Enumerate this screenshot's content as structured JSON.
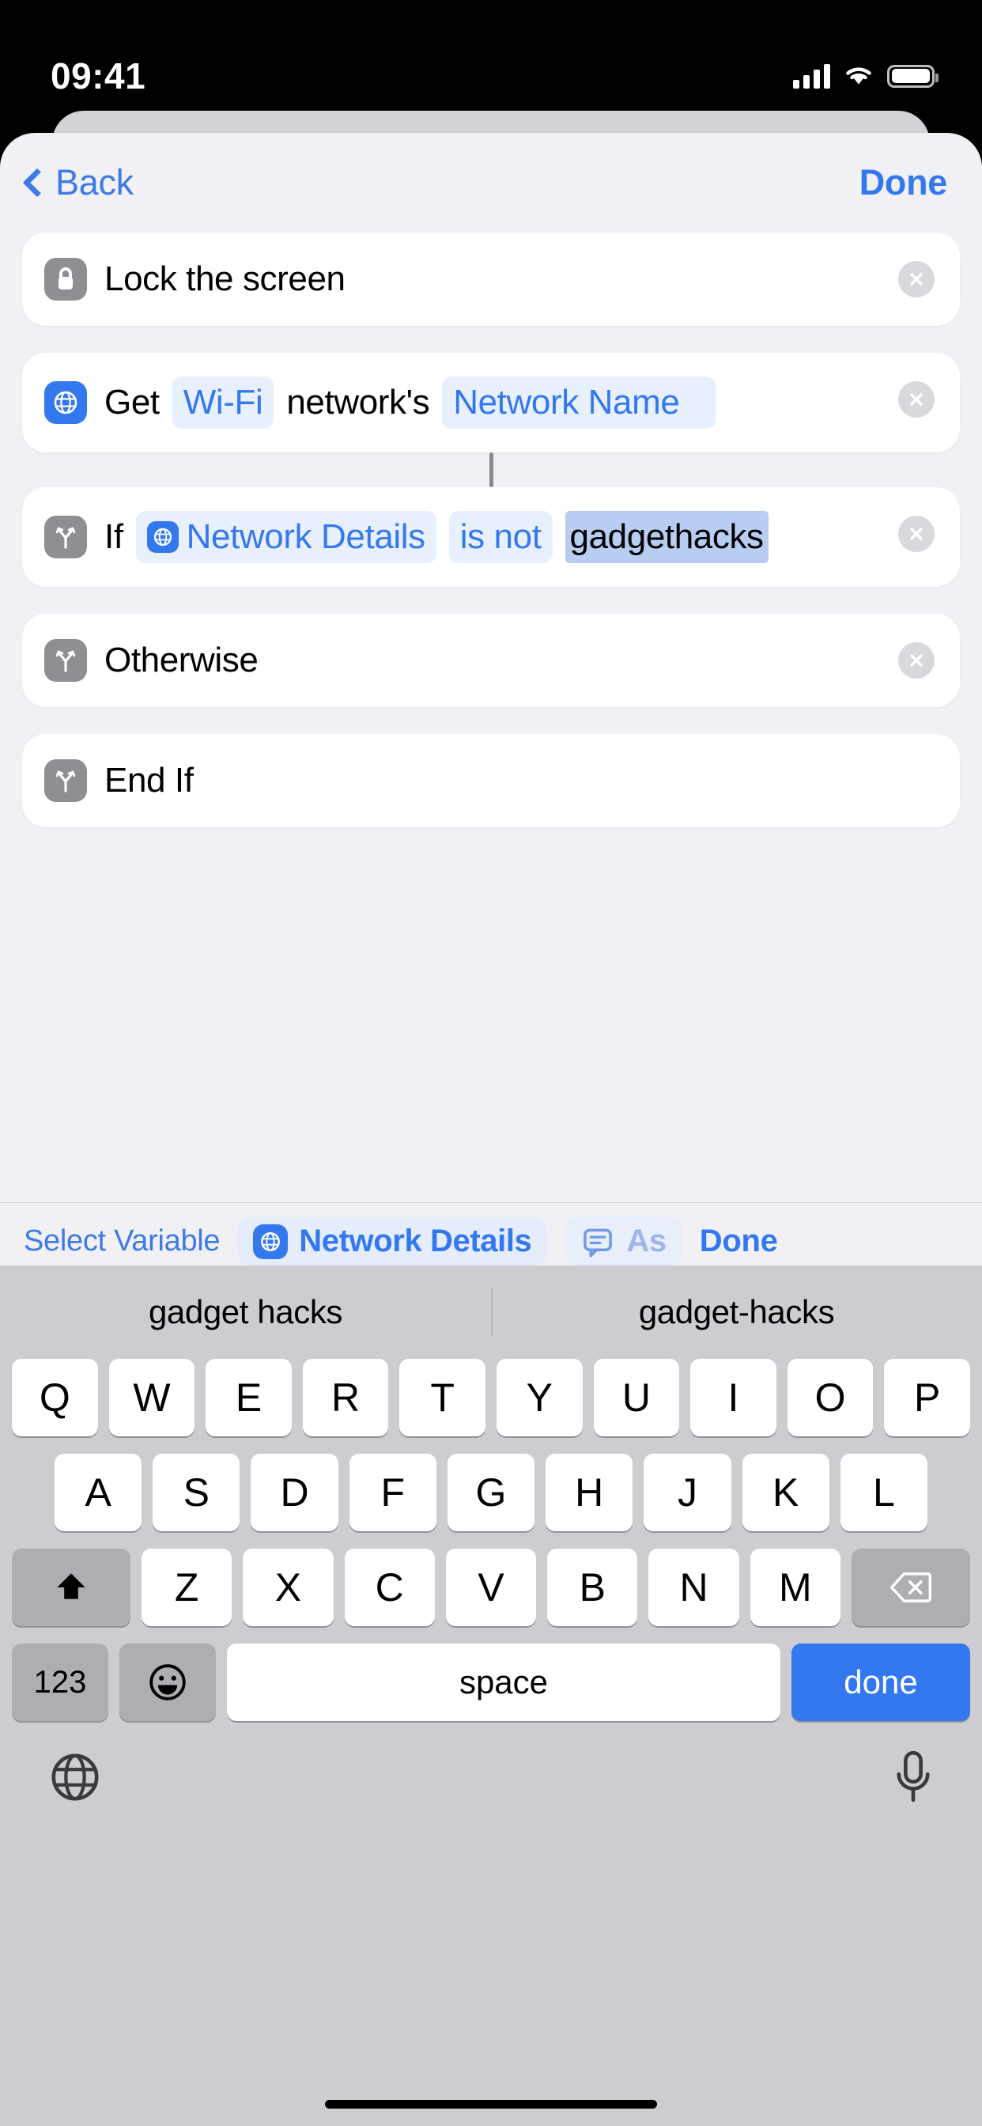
{
  "status_bar": {
    "time": "09:41",
    "signal_icon": "cellular-bars-icon",
    "wifi_icon": "wifi-icon",
    "battery_icon": "battery-icon"
  },
  "nav": {
    "back_label": "Back",
    "done_label": "Done",
    "back_icon": "chevron-left-icon"
  },
  "actions": [
    {
      "id": "lock-screen",
      "icon": "lock-icon",
      "icon_color": "#8e8e93",
      "parts": [
        {
          "type": "text",
          "value": "Lock the screen"
        }
      ],
      "remove_icon": "close-circle-icon"
    },
    {
      "id": "get-wifi-network",
      "icon": "globe-icon",
      "icon_color": "#3478f0",
      "parts": [
        {
          "type": "text",
          "value": "Get"
        },
        {
          "type": "token",
          "value": "Wi-Fi"
        },
        {
          "type": "text",
          "value": "network's"
        },
        {
          "type": "token",
          "value": "Network Name"
        }
      ],
      "remove_icon": "close-circle-icon"
    },
    {
      "id": "if-condition",
      "icon": "branch-icon",
      "icon_color": "#8e8e93",
      "parts": [
        {
          "type": "text",
          "value": "If"
        },
        {
          "type": "var-token",
          "value": "Network Details",
          "var_icon": "globe-icon"
        },
        {
          "type": "token",
          "value": "is not"
        },
        {
          "type": "highlight",
          "value": "gadgethacks"
        }
      ],
      "remove_icon": "close-circle-icon"
    },
    {
      "id": "otherwise",
      "icon": "branch-icon",
      "icon_color": "#8e8e93",
      "parts": [
        {
          "type": "text",
          "value": "Otherwise"
        }
      ],
      "remove_icon": "close-circle-icon"
    },
    {
      "id": "end-if",
      "icon": "branch-icon",
      "icon_color": "#8e8e93",
      "parts": [
        {
          "type": "text",
          "value": "End If"
        }
      ],
      "remove_icon": null
    }
  ],
  "variable_bar": {
    "select_label": "Select Variable",
    "chip_label": "Network Details",
    "chip_icon": "globe-icon",
    "ask_label": "As",
    "ask_icon": "speech-bubble-icon",
    "done_label": "Done"
  },
  "keyboard": {
    "suggestions": [
      "gadget hacks",
      "gadget-hacks"
    ],
    "row1": [
      "Q",
      "W",
      "E",
      "R",
      "T",
      "Y",
      "U",
      "I",
      "O",
      "P"
    ],
    "row2": [
      "A",
      "S",
      "D",
      "F",
      "G",
      "H",
      "J",
      "K",
      "L"
    ],
    "row3": [
      "Z",
      "X",
      "C",
      "V",
      "B",
      "N",
      "M"
    ],
    "shift_icon": "shift-up-icon",
    "backspace_icon": "backspace-icon",
    "numbers_label": "123",
    "emoji_icon": "emoji-smiley-icon",
    "space_label": "space",
    "return_label": "done",
    "globe_icon": "globe-keyboard-icon",
    "mic_icon": "microphone-icon"
  },
  "colors": {
    "accent": "#3478f0",
    "token_bg": "#e8f0fd",
    "selection": "#b8cdf2",
    "sheet_bg": "#f1f1f5",
    "keyboard_bg": "#ccccd1"
  }
}
